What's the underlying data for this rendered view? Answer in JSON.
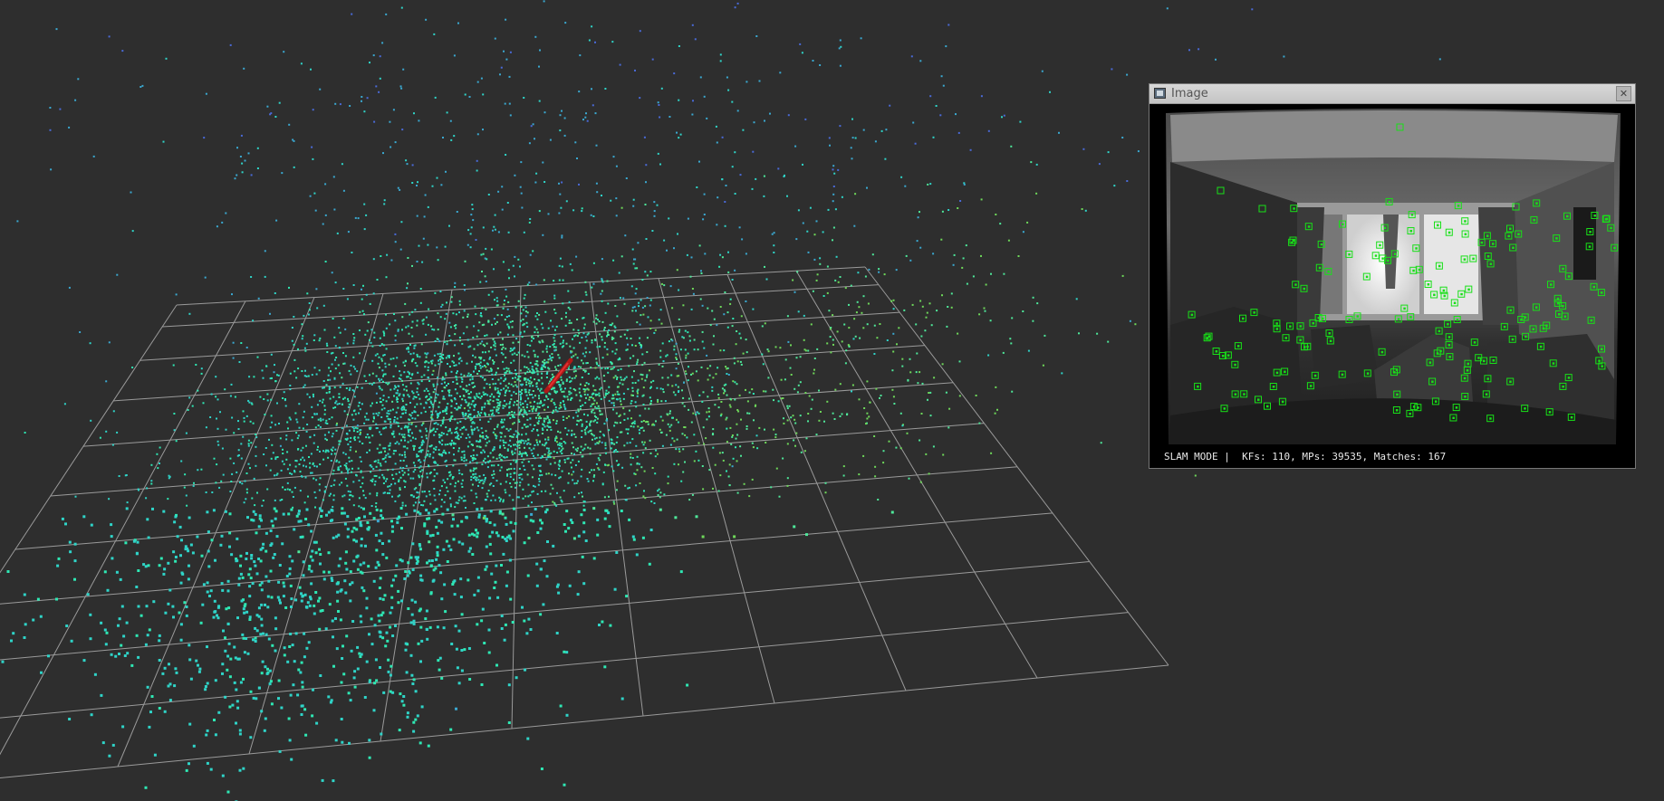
{
  "viewer": {
    "background": "#2e2e2e",
    "grid_color": "#9a9a9a",
    "point_colors": [
      "#2fd4c8",
      "#2ee8b4",
      "#4ee89a",
      "#6ed85a",
      "#3aa8d0",
      "#4a6ad8"
    ],
    "camera_color": "#b01818"
  },
  "image_window": {
    "title": "Image",
    "close_icon": "close-icon",
    "window_icon": "image-icon",
    "feature_color": "#18e018",
    "status": "SLAM MODE |  KFs: 110, MPs: 39535, Matches: 167"
  }
}
